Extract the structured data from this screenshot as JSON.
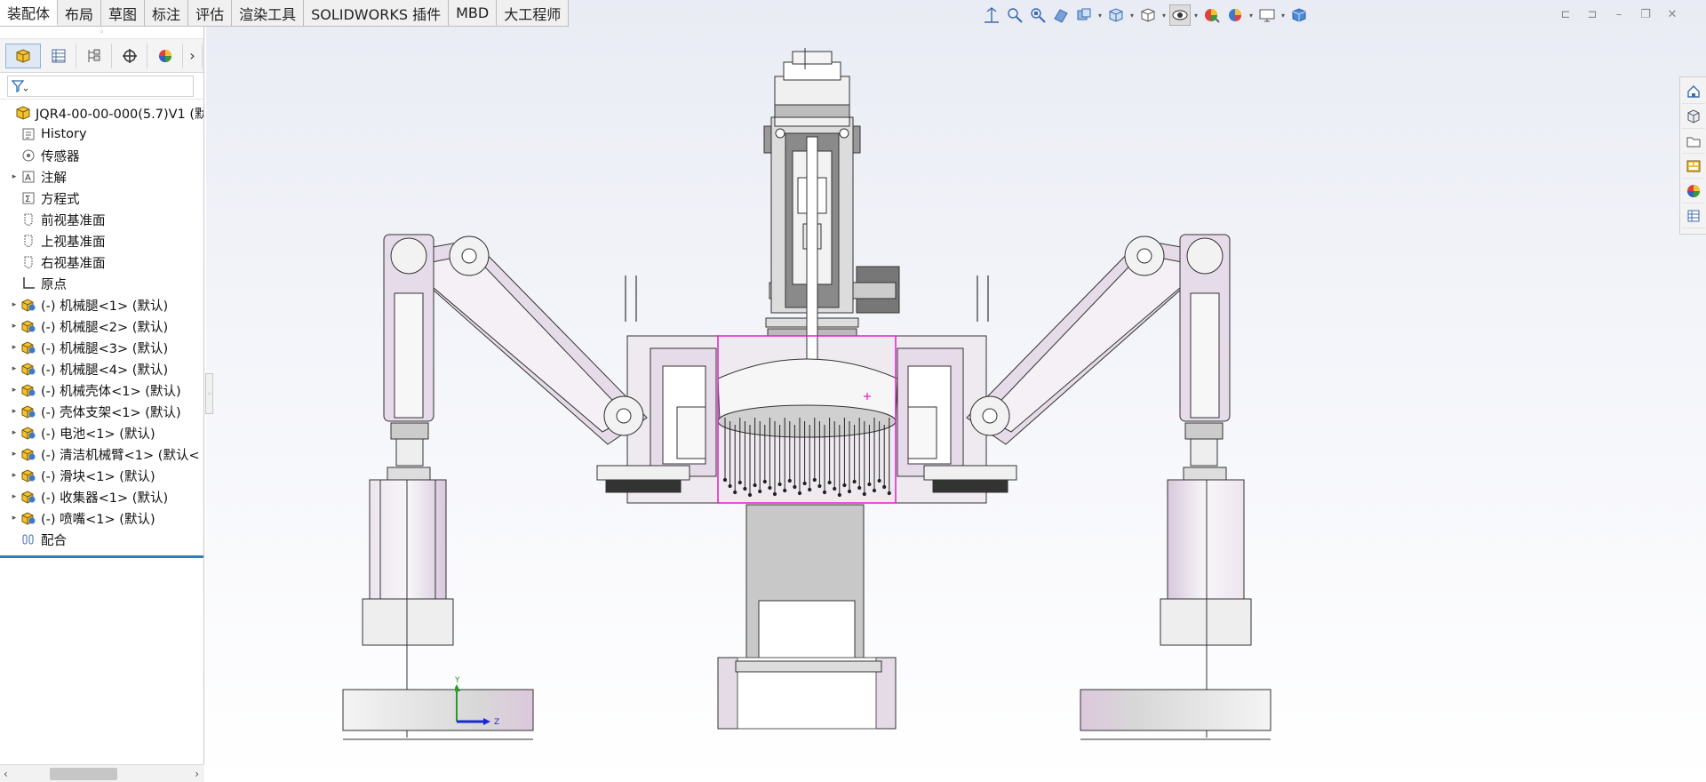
{
  "tabs": [
    {
      "label": "装配体",
      "active": true
    },
    {
      "label": "布局",
      "active": false
    },
    {
      "label": "草图",
      "active": false
    },
    {
      "label": "标注",
      "active": false
    },
    {
      "label": "评估",
      "active": false
    },
    {
      "label": "渲染工具",
      "active": false
    },
    {
      "label": "SOLIDWORKS 插件",
      "active": false
    },
    {
      "label": "MBD",
      "active": false
    },
    {
      "label": "大工程师",
      "active": false
    }
  ],
  "panel_tabs": [
    "feature-manager-icon",
    "property-manager-icon",
    "configuration-manager-icon",
    "dimxpert-manager-icon",
    "display-manager-icon"
  ],
  "feature_tree": {
    "root": {
      "label": "JQR4-00-00-000(5.7)V1  (默认",
      "icon": "assembly-icon"
    },
    "items": [
      {
        "label": "History",
        "icon": "history-icon",
        "expandable": false
      },
      {
        "label": "传感器",
        "icon": "sensor-icon",
        "expandable": false
      },
      {
        "label": "注解",
        "icon": "annotation-icon",
        "expandable": true
      },
      {
        "label": "方程式",
        "icon": "equation-icon",
        "expandable": false
      },
      {
        "label": "前视基准面",
        "icon": "plane-icon",
        "expandable": false
      },
      {
        "label": "上视基准面",
        "icon": "plane-icon",
        "expandable": false
      },
      {
        "label": "右视基准面",
        "icon": "plane-icon",
        "expandable": false
      },
      {
        "label": "原点",
        "icon": "origin-icon",
        "expandable": false
      },
      {
        "label": "(-) 机械腿<1> (默认)",
        "icon": "subassembly-icon",
        "expandable": true
      },
      {
        "label": "(-) 机械腿<2> (默认)",
        "icon": "subassembly-icon",
        "expandable": true
      },
      {
        "label": "(-) 机械腿<3> (默认)",
        "icon": "subassembly-icon",
        "expandable": true
      },
      {
        "label": "(-) 机械腿<4> (默认)",
        "icon": "subassembly-icon",
        "expandable": true
      },
      {
        "label": "(-) 机械壳体<1> (默认)",
        "icon": "subassembly-icon",
        "expandable": true
      },
      {
        "label": "(-) 壳体支架<1> (默认)",
        "icon": "subassembly-icon",
        "expandable": true
      },
      {
        "label": "(-) 电池<1> (默认)",
        "icon": "subassembly-icon",
        "expandable": true
      },
      {
        "label": "(-) 清洁机械臂<1> (默认<",
        "icon": "subassembly-icon",
        "expandable": true
      },
      {
        "label": "(-) 滑块<1> (默认)",
        "icon": "subassembly-icon",
        "expandable": true
      },
      {
        "label": "(-) 收集器<1> (默认)",
        "icon": "subassembly-icon",
        "expandable": true
      },
      {
        "label": "(-) 喷嘴<1> (默认)",
        "icon": "subassembly-icon",
        "expandable": true
      },
      {
        "label": "配合",
        "icon": "mates-icon",
        "expandable": false
      }
    ]
  },
  "hud_tools": [
    "zoom-to-fit-icon",
    "zoom-area-icon",
    "previous-view-icon",
    "section-view-icon",
    "dynamic-annotation-icon",
    "view-orientation-icon",
    "display-style-icon",
    "hide-show-items-icon",
    "edit-appearance-icon",
    "apply-scene-icon",
    "view-settings-icon",
    "3d-view-icon"
  ],
  "task_pane": [
    "home-icon",
    "design-library-icon",
    "file-explorer-icon",
    "view-palette-icon",
    "appearances-icon",
    "custom-properties-icon"
  ],
  "triad": {
    "y_label": "Y",
    "z_label": "Z"
  },
  "colors": {
    "accent": "#2f7fc1",
    "selection": "#e020c8",
    "part_fill": "#e6dbe8",
    "dark_part": "#5a5a5a"
  }
}
